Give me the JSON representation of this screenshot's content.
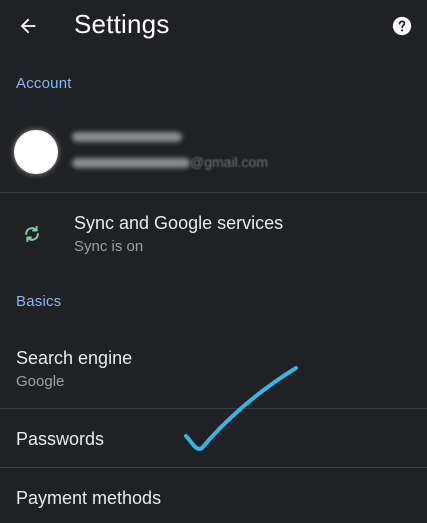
{
  "header": {
    "title": "Settings",
    "back_icon": "arrow-left",
    "help_icon": "help-circle"
  },
  "account": {
    "section_label": "Account",
    "profile": {
      "email_domain": "@gmail.com"
    },
    "sync": {
      "title": "Sync and Google services",
      "status": "Sync is on",
      "icon": "sync-icon"
    }
  },
  "basics": {
    "section_label": "Basics",
    "search_engine": {
      "title": "Search engine",
      "value": "Google"
    },
    "passwords": {
      "title": "Passwords"
    },
    "payment_methods": {
      "title": "Payment methods"
    }
  },
  "colors": {
    "background": "#202124",
    "accent": "#8ab4f8",
    "sync_green": "#81c995",
    "check_blue": "#35b6e6"
  }
}
